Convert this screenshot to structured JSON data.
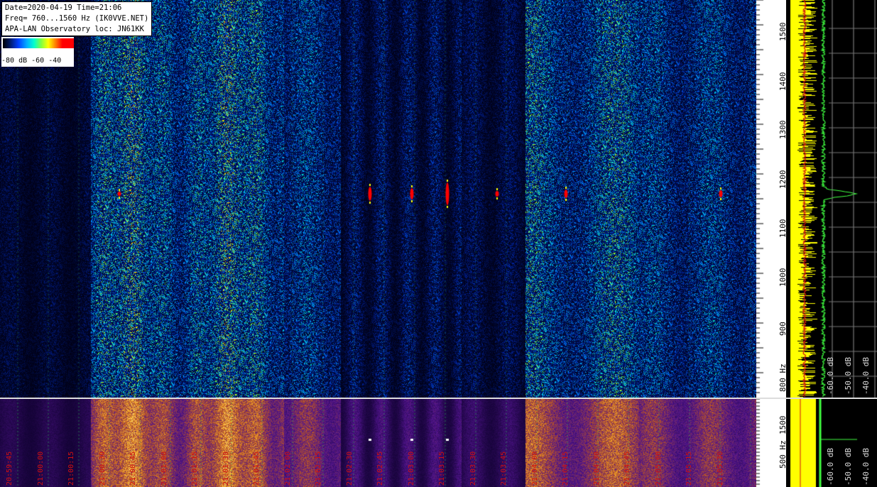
{
  "info": {
    "line1": "Date=2020-04-19 Time=21:06",
    "line2": "Freq= 760...1560 Hz (IK0VVE.NET)",
    "line3": "APA-LAN Observatory loc: JN61KK"
  },
  "legend": {
    "ticks": "-80 dB -60     -40"
  },
  "freq_axis_top": {
    "labels": [
      "1500",
      "1400",
      "1300",
      "1200",
      "1100",
      "1000",
      "900",
      "800 Hz"
    ]
  },
  "freq_axis_bottom": {
    "labels": [
      "1500",
      "500 Hz"
    ]
  },
  "spectrum_top": {
    "db_labels": [
      "-60.0 dB",
      "-50.0 dB",
      "-40.0 dB"
    ]
  },
  "spectrum_bottom": {
    "db_labels": [
      "-60.0 dB",
      "-50.0 dB",
      "-40.0 dB"
    ]
  },
  "time_axis": {
    "labels": [
      "20:59:45",
      "21:00:00",
      "21:00:15",
      "21:00:30",
      "21:00:45",
      "21:01:00",
      "21:01:15",
      "21:01:30",
      "21:01:45",
      "21:02:00",
      "21:02:15",
      "21:02:30",
      "21:02:45",
      "21:03:00",
      "21:03:15",
      "21:03:30",
      "21:03:45",
      "21:04:00",
      "21:04:15",
      "21:04:30",
      "21:04:45",
      "21:05:00",
      "21:05:15",
      "21:05:30"
    ]
  },
  "colors": {
    "time_label": "#d01010"
  }
}
